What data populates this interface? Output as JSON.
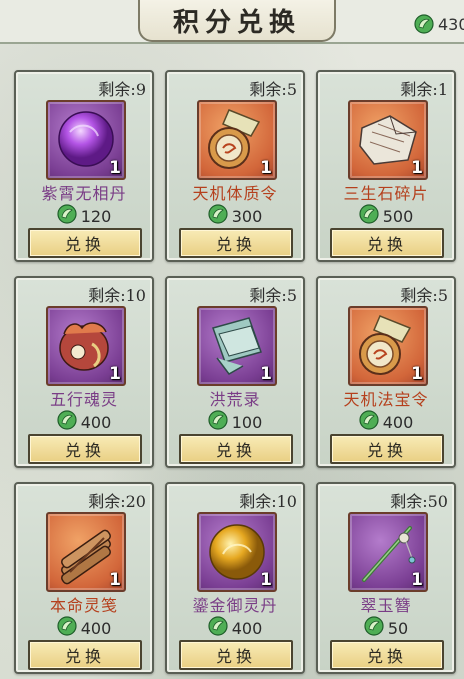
{
  "header": {
    "title": "积分兑换",
    "currency_icon": "jade-leaf-icon",
    "currency_amount": "430"
  },
  "colors": {
    "purple_name": "#7a3d86",
    "orange_name": "#b5401d",
    "button_fill": "#efd98e",
    "card_bg": "#cfd9cd"
  },
  "items": [
    {
      "remain": "剩余:9",
      "name": "紫霄无相丹",
      "qty": "1",
      "price": "120",
      "button": "兑换",
      "icon": "purple-orb-icon",
      "rarity": "purple"
    },
    {
      "remain": "剩余:5",
      "name": "天机体质令",
      "qty": "1",
      "price": "300",
      "button": "兑换",
      "icon": "jade-token-icon",
      "rarity": "orange"
    },
    {
      "remain": "剩余:1",
      "name": "三生石碎片",
      "qty": "1",
      "price": "500",
      "button": "兑换",
      "icon": "stone-shard-icon",
      "rarity": "orange"
    },
    {
      "remain": "剩余:10",
      "name": "五行魂灵",
      "qty": "1",
      "price": "400",
      "button": "兑换",
      "icon": "spirit-creature-icon",
      "rarity": "purple"
    },
    {
      "remain": "剩余:5",
      "name": "洪荒录",
      "qty": "1",
      "price": "100",
      "button": "兑换",
      "icon": "scroll-book-icon",
      "rarity": "purple"
    },
    {
      "remain": "剩余:5",
      "name": "天机法宝令",
      "qty": "1",
      "price": "400",
      "button": "兑换",
      "icon": "jade-token-icon",
      "rarity": "orange"
    },
    {
      "remain": "剩余:20",
      "name": "本命灵笺",
      "qty": "1",
      "price": "400",
      "button": "兑换",
      "icon": "bamboo-slips-icon",
      "rarity": "orange"
    },
    {
      "remain": "剩余:10",
      "name": "鎏金御灵丹",
      "qty": "1",
      "price": "400",
      "button": "兑换",
      "icon": "golden-pill-icon",
      "rarity": "purple"
    },
    {
      "remain": "剩余:50",
      "name": "翠玉簪",
      "qty": "1",
      "price": "50",
      "button": "兑换",
      "icon": "jade-hairpin-icon",
      "rarity": "purple"
    }
  ]
}
